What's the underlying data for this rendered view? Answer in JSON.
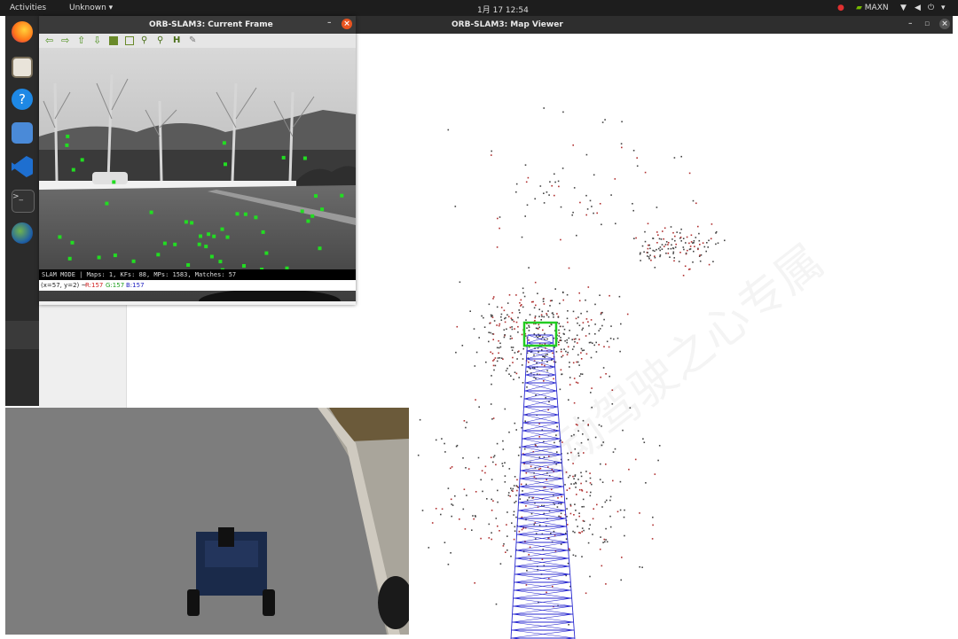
{
  "topbar": {
    "activities": "Activities",
    "app_menu": "Unknown",
    "clock": "1月 17  12:54",
    "nvidia": "MAXN"
  },
  "map_viewer": {
    "title": "ORB-SLAM3: Map Viewer"
  },
  "current_frame": {
    "title": "ORB-SLAM3: Current Frame",
    "status_text": "SLAM MODE |  Maps: 1, KFs: 88, MPs: 1583, Matches: 57",
    "pixel_info": {
      "coords": "(x=57, y=2) ~ ",
      "r": "R:157",
      "g": "G:157",
      "b": "B:157"
    }
  },
  "watermark": "自动驾驶之心专属",
  "colors": {
    "trajectory": "#2a2ad0",
    "current_camera": "#22cc22",
    "features": "#22dd22"
  }
}
